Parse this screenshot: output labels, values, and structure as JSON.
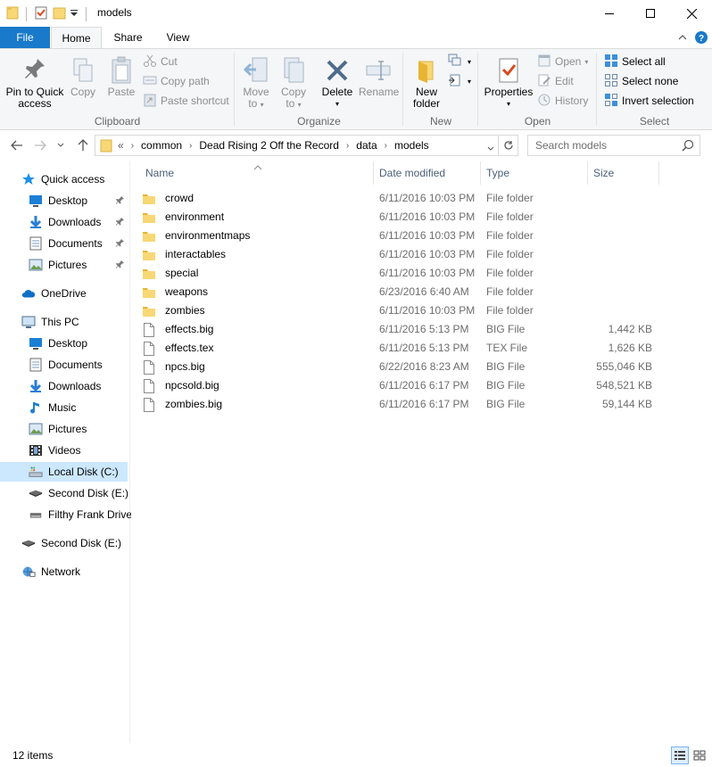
{
  "window": {
    "title": "models"
  },
  "ribbon_tabs": [
    "File",
    "Home",
    "Share",
    "View"
  ],
  "ribbon": {
    "clipboard": {
      "label": "Clipboard",
      "pin_line1": "Pin to Quick",
      "pin_line2": "access",
      "copy": "Copy",
      "paste": "Paste",
      "cut": "Cut",
      "copy_path": "Copy path",
      "paste_shortcut": "Paste shortcut"
    },
    "organize": {
      "label": "Organize",
      "move_line1": "Move",
      "move_line2": "to",
      "copy_line1": "Copy",
      "copy_line2": "to",
      "delete": "Delete",
      "rename": "Rename"
    },
    "new": {
      "label": "New",
      "folder_line1": "New",
      "folder_line2": "folder"
    },
    "open": {
      "label": "Open",
      "properties": "Properties",
      "open": "Open",
      "edit": "Edit",
      "history": "History"
    },
    "select": {
      "label": "Select",
      "select_all": "Select all",
      "select_none": "Select none",
      "invert": "Invert selection"
    }
  },
  "address": {
    "overflow": "«",
    "crumbs": [
      "common",
      "Dead Rising 2 Off the Record",
      "data",
      "models"
    ]
  },
  "search": {
    "placeholder": "Search models"
  },
  "sidebar": {
    "items": [
      {
        "label": "Quick access",
        "icon": "star-icon",
        "pinned": false
      },
      {
        "label": "Desktop",
        "icon": "desktop-icon",
        "pinned": true
      },
      {
        "label": "Downloads",
        "icon": "download-icon",
        "pinned": true
      },
      {
        "label": "Documents",
        "icon": "documents-icon",
        "pinned": true
      },
      {
        "label": "Pictures",
        "icon": "pictures-icon",
        "pinned": true
      },
      {
        "label": "OneDrive",
        "icon": "cloud-icon",
        "pinned": false
      },
      {
        "label": "This PC",
        "icon": "computer-icon",
        "pinned": false
      },
      {
        "label": "Desktop",
        "icon": "desktop-icon",
        "pinned": false
      },
      {
        "label": "Documents",
        "icon": "documents-icon",
        "pinned": false
      },
      {
        "label": "Downloads",
        "icon": "download-icon",
        "pinned": false
      },
      {
        "label": "Music",
        "icon": "music-icon",
        "pinned": false
      },
      {
        "label": "Pictures",
        "icon": "pictures-icon",
        "pinned": false
      },
      {
        "label": "Videos",
        "icon": "videos-icon",
        "pinned": false
      },
      {
        "label": "Local Disk (C:)",
        "icon": "local-disk-icon",
        "pinned": false,
        "selected": true
      },
      {
        "label": "Second Disk (E:)",
        "icon": "drive-icon",
        "pinned": false
      },
      {
        "label": "Filthy Frank Drive",
        "icon": "usb-drive-icon",
        "pinned": false
      },
      {
        "label": "Second Disk (E:)",
        "icon": "drive-icon",
        "pinned": false
      },
      {
        "label": "Network",
        "icon": "network-icon",
        "pinned": false
      }
    ]
  },
  "columns": {
    "name": "Name",
    "date": "Date modified",
    "type": "Type",
    "size": "Size"
  },
  "files": [
    {
      "name": "crowd",
      "date": "6/11/2016 10:03 PM",
      "type": "File folder",
      "size": "",
      "icon": "folder-icon"
    },
    {
      "name": "environment",
      "date": "6/11/2016 10:03 PM",
      "type": "File folder",
      "size": "",
      "icon": "folder-icon"
    },
    {
      "name": "environmentmaps",
      "date": "6/11/2016 10:03 PM",
      "type": "File folder",
      "size": "",
      "icon": "folder-icon"
    },
    {
      "name": "interactables",
      "date": "6/11/2016 10:03 PM",
      "type": "File folder",
      "size": "",
      "icon": "folder-icon"
    },
    {
      "name": "special",
      "date": "6/11/2016 10:03 PM",
      "type": "File folder",
      "size": "",
      "icon": "folder-icon"
    },
    {
      "name": "weapons",
      "date": "6/23/2016 6:40 AM",
      "type": "File folder",
      "size": "",
      "icon": "folder-icon"
    },
    {
      "name": "zombies",
      "date": "6/11/2016 10:03 PM",
      "type": "File folder",
      "size": "",
      "icon": "folder-icon"
    },
    {
      "name": "effects.big",
      "date": "6/11/2016 5:13 PM",
      "type": "BIG File",
      "size": "1,442 KB",
      "icon": "file-icon"
    },
    {
      "name": "effects.tex",
      "date": "6/11/2016 5:13 PM",
      "type": "TEX File",
      "size": "1,626 KB",
      "icon": "file-icon"
    },
    {
      "name": "npcs.big",
      "date": "6/22/2016 8:23 AM",
      "type": "BIG File",
      "size": "555,046 KB",
      "icon": "file-icon"
    },
    {
      "name": "npcsold.big",
      "date": "6/11/2016 6:17 PM",
      "type": "BIG File",
      "size": "548,521 KB",
      "icon": "file-icon"
    },
    {
      "name": "zombies.big",
      "date": "6/11/2016 6:17 PM",
      "type": "BIG File",
      "size": "59,144 KB",
      "icon": "file-icon"
    }
  ],
  "status": {
    "items": "12 items"
  },
  "colors": {
    "accent": "#1979ca",
    "selected": "#cce8ff",
    "folder": "#f8d775",
    "header_text": "#4c607a"
  }
}
